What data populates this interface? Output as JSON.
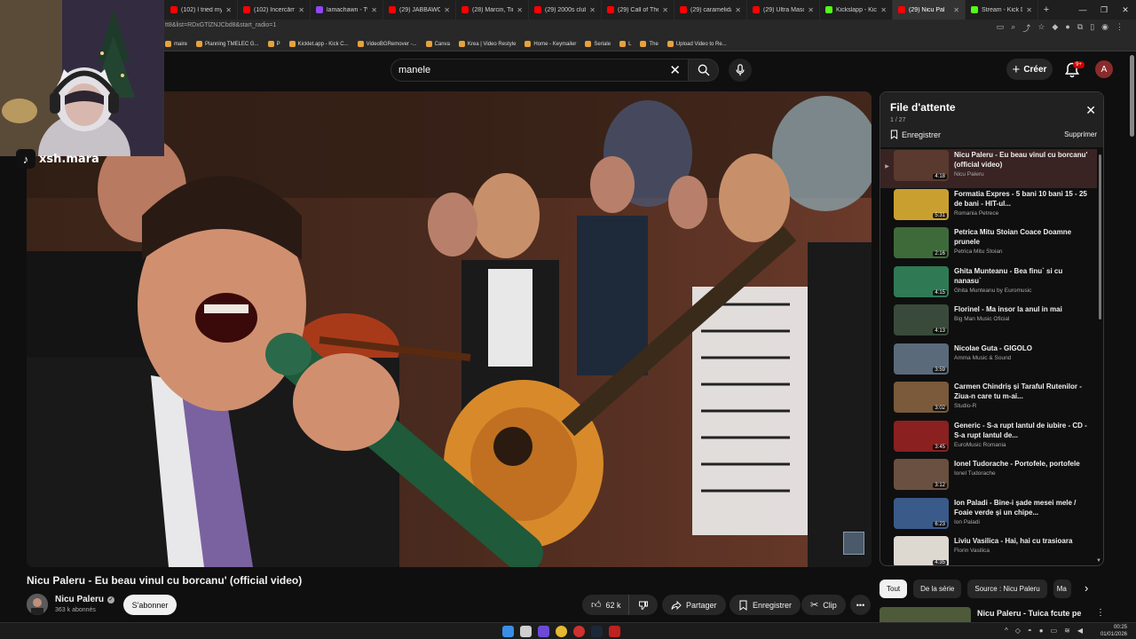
{
  "browser": {
    "tabs": [
      {
        "label": "(102) I tried my f",
        "color": "#ff0000"
      },
      {
        "label": "(102) Încercăm U",
        "color": "#ff0000"
      },
      {
        "label": "lamachawn - Twi",
        "color": "#9146ff"
      },
      {
        "label": "(29) JABBAWOCK",
        "color": "#ff0000"
      },
      {
        "label": "(28) Marcin, Tim",
        "color": "#ff0000"
      },
      {
        "label": "(29) 2000s club v",
        "color": "#ff0000"
      },
      {
        "label": "(29) Call of The N",
        "color": "#ff0000"
      },
      {
        "label": "(29) caramelidan",
        "color": "#ff0000"
      },
      {
        "label": "(29) Ultra Mascul",
        "color": "#ff0000"
      },
      {
        "label": "Kickslapp - Kick",
        "color": "#53fc18"
      },
      {
        "label": "(29) Nicu Pal",
        "color": "#ff0000",
        "active": true
      },
      {
        "label": "Stream - Kick Da",
        "color": "#53fc18"
      }
    ],
    "url": "tt8&list=RDxGTlZNJCbd8&start_radio=1",
    "bookmarks": [
      "maire",
      "Planning TMELEC G...",
      "P",
      "Kicklet.app - Kick C...",
      "VideoBGRemover -...",
      "Canva",
      "Krea | Video Restyle",
      "Home - Keymailer",
      "Seriale",
      "L",
      "The",
      "Upload Video to Re..."
    ]
  },
  "masthead": {
    "search_value": "manele",
    "create_label": "Créer",
    "notifications_badge": "9+",
    "avatar_letter": "A"
  },
  "overlay": {
    "tiktok_handle": "xsh.mara"
  },
  "video": {
    "title": "Nicu Paleru - Eu beau vinul cu borcanu' (official video)",
    "channel": "Nicu Paleru",
    "subscribers": "363 k abonnés",
    "subscribe_label": "S'abonner",
    "likes": "62 k",
    "share_label": "Partager",
    "save_label": "Enregistrer",
    "clip_label": "Clip"
  },
  "queue": {
    "title": "File d'attente",
    "position": "1 / 27",
    "save_label": "Enregistrer",
    "delete_label": "Supprimer",
    "items": [
      {
        "title": "Nicu Paleru - Eu beau vinul cu borcanu' (official video)",
        "channel": "Nicu Paleru",
        "duration": "4:18",
        "thumb": "#5a3a2e",
        "active": true
      },
      {
        "title": "Formatia Expres - 5 bani 10 bani 15 - 25 de bani - HIT-ul...",
        "channel": "Romania Petrece",
        "duration": "5:31",
        "thumb": "#c9a030"
      },
      {
        "title": "Petrica Mitu Stoian Coace Doamne prunele",
        "channel": "Petrica Mitu Stoian",
        "duration": "2:16",
        "thumb": "#3e6a3a"
      },
      {
        "title": "Ghita Munteanu - Bea finu` si cu nanasu`",
        "channel": "Ghita Munteanu by Euromusic",
        "duration": "4:15",
        "thumb": "#2f7a55"
      },
      {
        "title": "Florinel - Ma insor la anul in mai",
        "channel": "Big Man Music Oficial",
        "duration": "4:13",
        "thumb": "#3a4a3a"
      },
      {
        "title": "Nicolae Guta - GIGOLO",
        "channel": "Amma Music & Sound",
        "duration": "3:59",
        "thumb": "#5a6a7a"
      },
      {
        "title": "Carmen Chindriș și Taraful Rutenilor - Ziua-n care tu m-ai...",
        "channel": "Studio-R",
        "duration": "3:02",
        "thumb": "#7a5a3a"
      },
      {
        "title": "Generic - S-a rupt lantul de iubire - CD - S-a rupt lantul de...",
        "channel": "EuroMusic Romania",
        "duration": "3:45",
        "thumb": "#8a2020"
      },
      {
        "title": "Ionel Tudorache - Portofele, portofele",
        "channel": "Ionel Tudorache",
        "duration": "3:12",
        "thumb": "#6a5040"
      },
      {
        "title": "Ion Paladi - Bine-i șade mesei mele / Foaie verde și un chipe...",
        "channel": "Ion Paladi",
        "duration": "6:23",
        "thumb": "#3a5a8a"
      },
      {
        "title": "Liviu Vasilica - Hai, hai cu trasioara",
        "channel": "Florin Vasilica",
        "duration": "4:35",
        "thumb": "#ddd8d0"
      }
    ]
  },
  "chips": [
    {
      "label": "Tout",
      "active": true
    },
    {
      "label": "De la série"
    },
    {
      "label": "Source : Nicu Paleru"
    },
    {
      "label": "Ma"
    }
  ],
  "recommendation": {
    "title": "Nicu Paleru - Tuica fcute pe"
  },
  "taskbar": {
    "time": "00:25",
    "date": "01/01/2026"
  }
}
